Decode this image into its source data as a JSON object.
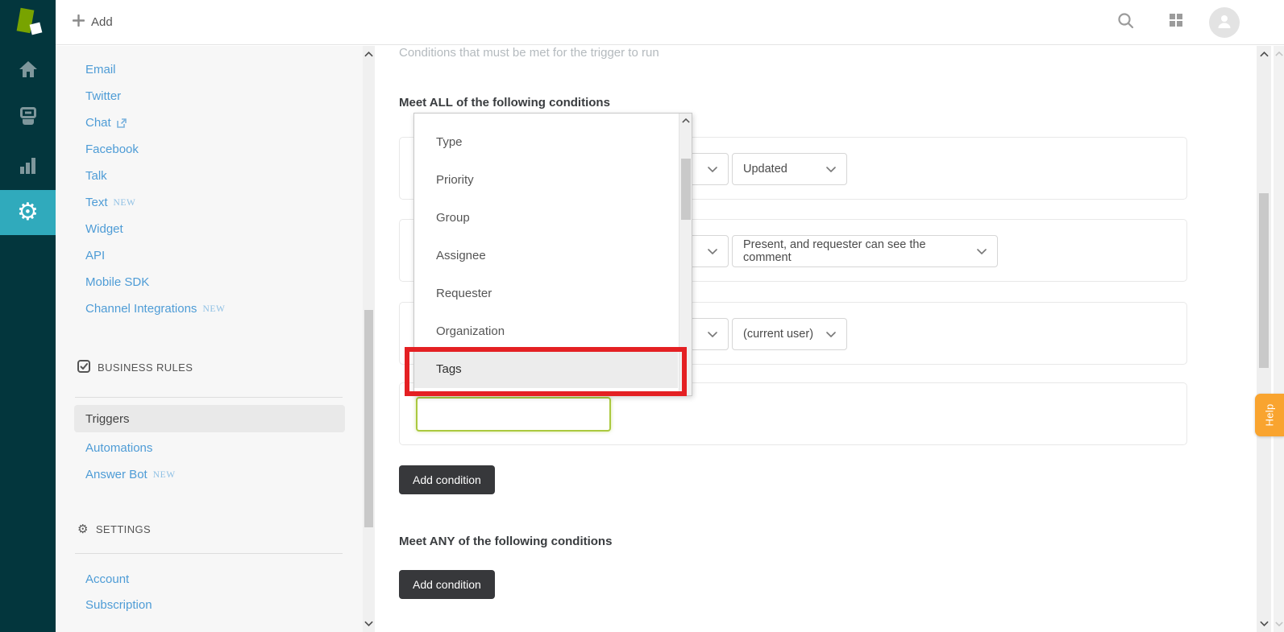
{
  "topbar": {
    "add_label": "Add"
  },
  "sidebar": {
    "channels": [
      {
        "label": "Email"
      },
      {
        "label": "Twitter"
      },
      {
        "label": "Chat"
      },
      {
        "label": "Facebook"
      },
      {
        "label": "Talk"
      },
      {
        "label": "Text",
        "badge": "NEW"
      },
      {
        "label": "Widget"
      },
      {
        "label": "API"
      },
      {
        "label": "Mobile SDK"
      },
      {
        "label": "Channel Integrations",
        "badge": "NEW"
      }
    ],
    "business_rules": {
      "title": "BUSINESS RULES",
      "items": [
        {
          "label": "Triggers",
          "selected": true
        },
        {
          "label": "Automations"
        },
        {
          "label": "Answer Bot",
          "badge": "NEW"
        }
      ]
    },
    "settings": {
      "title": "SETTINGS",
      "items": [
        {
          "label": "Account"
        },
        {
          "label": "Subscription"
        }
      ]
    }
  },
  "main": {
    "description": "Conditions that must be met for the trigger to run",
    "meet_all": {
      "pre": "Meet ALL",
      "post": " of the following conditions"
    },
    "meet_any": {
      "pre": "Meet ANY",
      "post": " of the following conditions"
    },
    "add_condition": "Add condition",
    "conditions": [
      {
        "value": "Updated"
      },
      {
        "value": "Present, and requester can see the comment"
      },
      {
        "value": "(current user)"
      }
    ],
    "field_dropdown": {
      "items": [
        "Type",
        "Priority",
        "Group",
        "Assignee",
        "Requester",
        "Organization",
        "Tags"
      ],
      "highlighted": "Tags"
    },
    "tags_input_value": ""
  },
  "help": {
    "label": "Help"
  },
  "colors": {
    "rail_dark": "#03363d",
    "rail_active_teal": "#30aabc",
    "brand_green": "#78a300",
    "link_blue": "#4e9cd6",
    "help_orange": "#f9a42f",
    "annotation_red": "#e42023",
    "input_green": "#abc93f",
    "button_dark": "#37383b"
  }
}
